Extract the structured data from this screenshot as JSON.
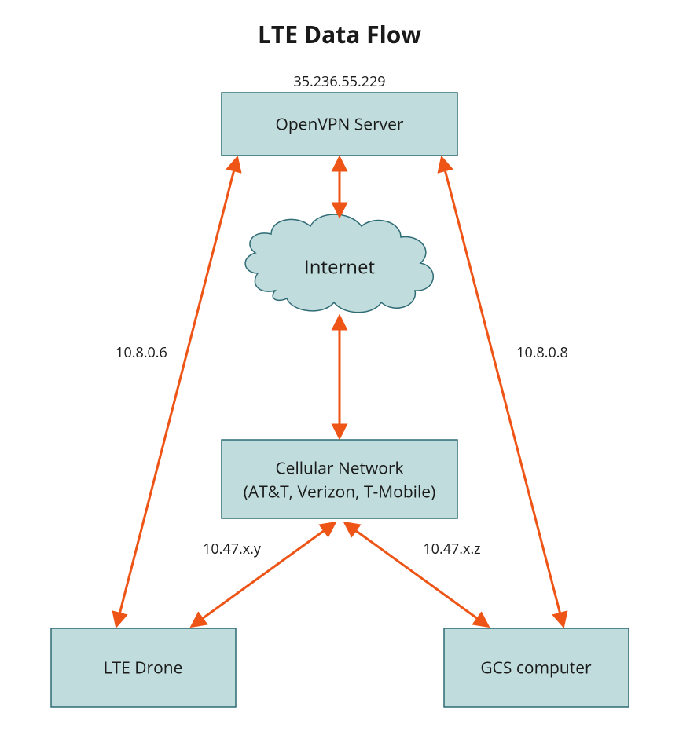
{
  "title": "LTE Data Flow",
  "nodes": {
    "openvpn": {
      "label": "OpenVPN Server",
      "ip": "35.236.55.229"
    },
    "internet": {
      "label": "Internet"
    },
    "cellular": {
      "label_line1": "Cellular Network",
      "label_line2": "(AT&T, Verizon, T-Mobile)"
    },
    "drone": {
      "label": "LTE Drone"
    },
    "gcs": {
      "label": "GCS computer"
    }
  },
  "edge_labels": {
    "drone_vpn": "10.8.0.6",
    "gcs_vpn": "10.8.0.8",
    "drone_cell": "10.47.x.y",
    "gcs_cell": "10.47.x.z"
  },
  "colors": {
    "node_fill": "#c0dcdc",
    "node_stroke": "#2f6b75",
    "arrow": "#ed5415"
  }
}
